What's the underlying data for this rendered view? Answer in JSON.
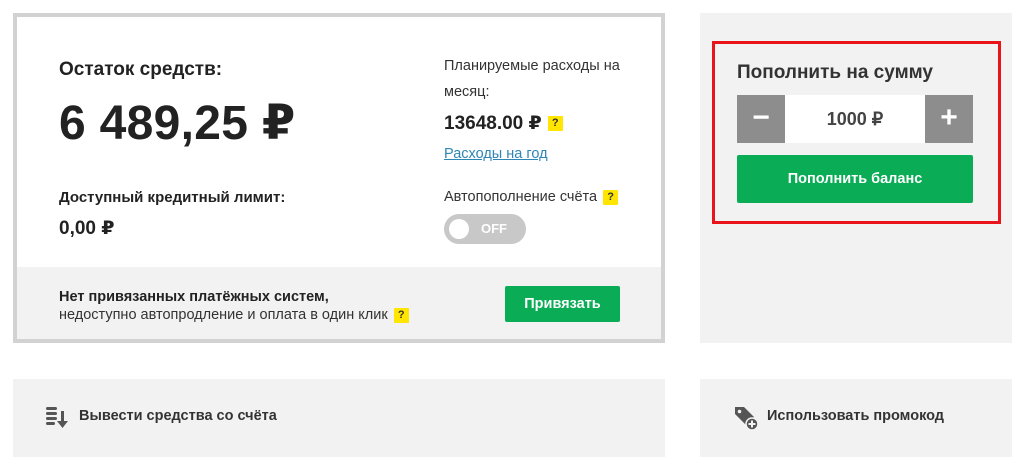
{
  "balance": {
    "title": "Остаток средств:",
    "amount": "6 489,25 ₽",
    "credit_label": "Доступный кредитный лимит:",
    "credit_value": "0,00 ₽"
  },
  "planned": {
    "label": "Планируемые расходы на месяц:",
    "value": "13648.00 ₽",
    "help": "?",
    "year_link": "Расходы на год"
  },
  "autorefill": {
    "label": "Автопополнение счёта",
    "help": "?",
    "toggle_text": "OFF"
  },
  "payment": {
    "title": "Нет привязанных платёжных систем,",
    "subtitle": "недоступно автопродление и оплата в один клик",
    "help": "?",
    "bind_button": "Привязать"
  },
  "topup": {
    "title": "Пополнить на сумму",
    "minus": "−",
    "plus": "+",
    "amount_value": "1000 ₽",
    "button": "Пополнить баланс"
  },
  "actions": {
    "withdraw": "Вывести средства со счёта",
    "promo": "Использовать промокод"
  },
  "colors": {
    "accent_green": "#0aac56",
    "highlight_red": "#e8141a",
    "help_yellow": "#ffe500",
    "link_blue": "#2e86b5"
  },
  "icons": {
    "withdraw": "coins-arrow-down-icon",
    "promo": "tag-plus-icon"
  }
}
